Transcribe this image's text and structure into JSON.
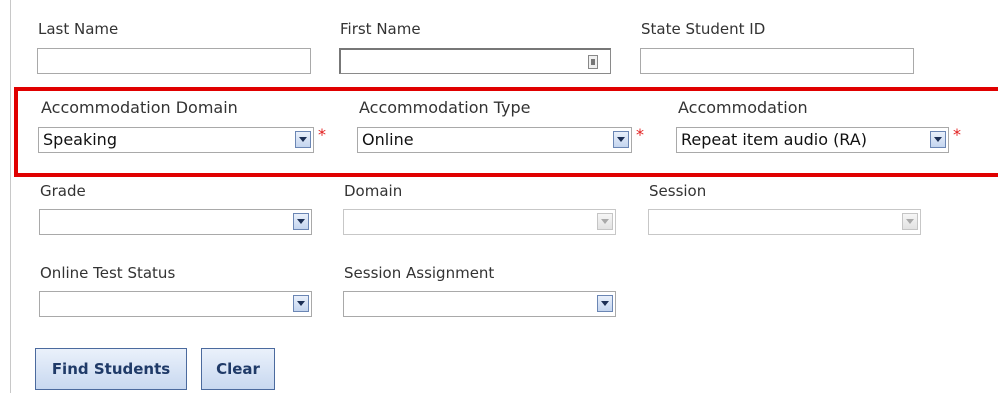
{
  "fields": {
    "last_name": {
      "label": "Last Name",
      "value": ""
    },
    "first_name": {
      "label": "First Name",
      "value": ""
    },
    "state_student_id": {
      "label": "State Student ID",
      "value": ""
    }
  },
  "accommodation": {
    "domain": {
      "label": "Accommodation Domain",
      "value": "Speaking",
      "required_mark": "*"
    },
    "type": {
      "label": "Accommodation Type",
      "value": "Online",
      "required_mark": "*"
    },
    "accommodation": {
      "label": "Accommodation",
      "value": "Repeat item audio (RA)",
      "required_mark": "*"
    }
  },
  "filters": {
    "grade": {
      "label": "Grade",
      "value": ""
    },
    "domain": {
      "label": "Domain",
      "value": ""
    },
    "session": {
      "label": "Session",
      "value": ""
    },
    "online_test_status": {
      "label": "Online Test Status",
      "value": ""
    },
    "session_assignment": {
      "label": "Session Assignment",
      "value": ""
    }
  },
  "buttons": {
    "find_students": "Find Students",
    "clear": "Clear"
  },
  "colors": {
    "highlight_border": "#e00000",
    "required": "#e21c1c",
    "button_text": "#1f3a68"
  }
}
